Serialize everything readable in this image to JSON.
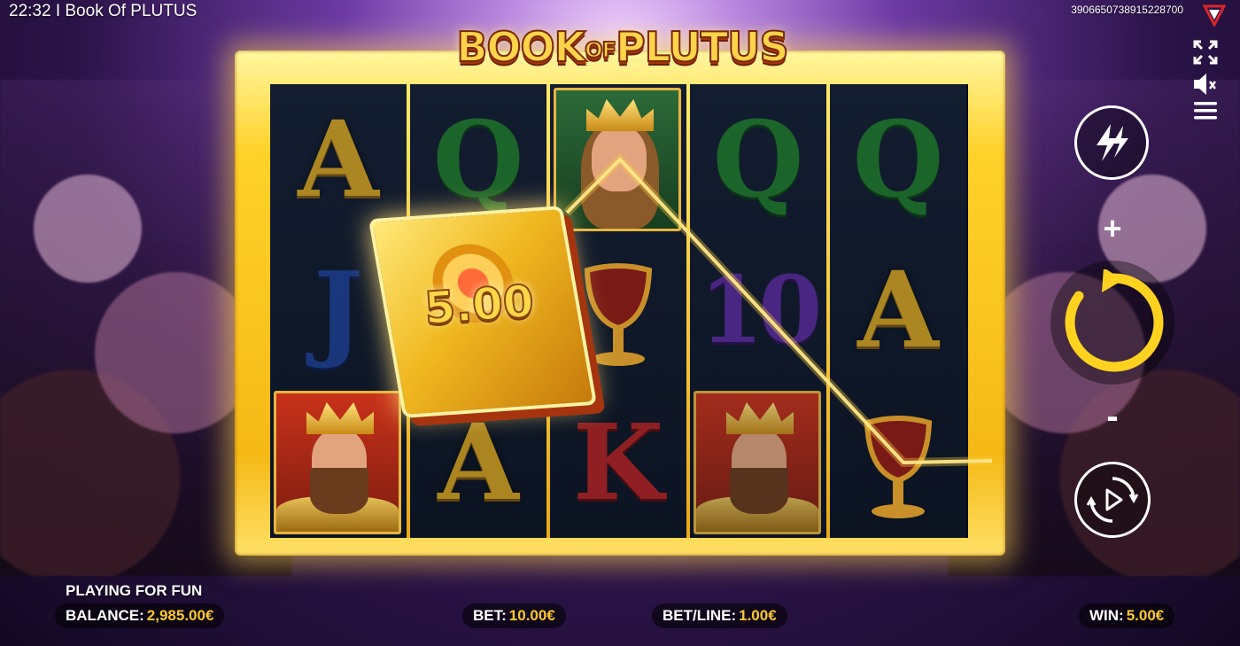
{
  "window": {
    "title": "22:32 I Book Of PLUTUS"
  },
  "session_id": "3906650738915228700",
  "game": {
    "logo_text_1": "BOOK",
    "logo_text_2": "OF",
    "logo_text_3": "PLUTUS"
  },
  "reels": [
    [
      "A",
      "J",
      "king"
    ],
    [
      "Q",
      "book",
      "A"
    ],
    [
      "queen",
      "chalice",
      "K"
    ],
    [
      "Q",
      "10",
      "king"
    ],
    [
      "Q",
      "A",
      "chalice"
    ]
  ],
  "book_win_value": "5.00",
  "controls": {
    "plus_label": "+",
    "minus_label": "-"
  },
  "footer": {
    "mode_label": "PLAYING FOR FUN",
    "balance_label": "BALANCE:",
    "balance_value": "2,985.00€",
    "bet_label": "BET:",
    "bet_value": "10.00€",
    "betline_label": "BET/LINE:",
    "betline_value": "1.00€",
    "win_label": "WIN:",
    "win_value": "5.00€"
  },
  "colors": {
    "accent_gold": "#ffc928",
    "spin_yellow": "#ffd21f",
    "frame_gold": "#ffd22a"
  },
  "icons": [
    "brand-logo-icon",
    "fullscreen-icon",
    "sound-muted-icon",
    "menu-icon",
    "turbo-icon",
    "spin-icon",
    "autoplay-icon"
  ]
}
